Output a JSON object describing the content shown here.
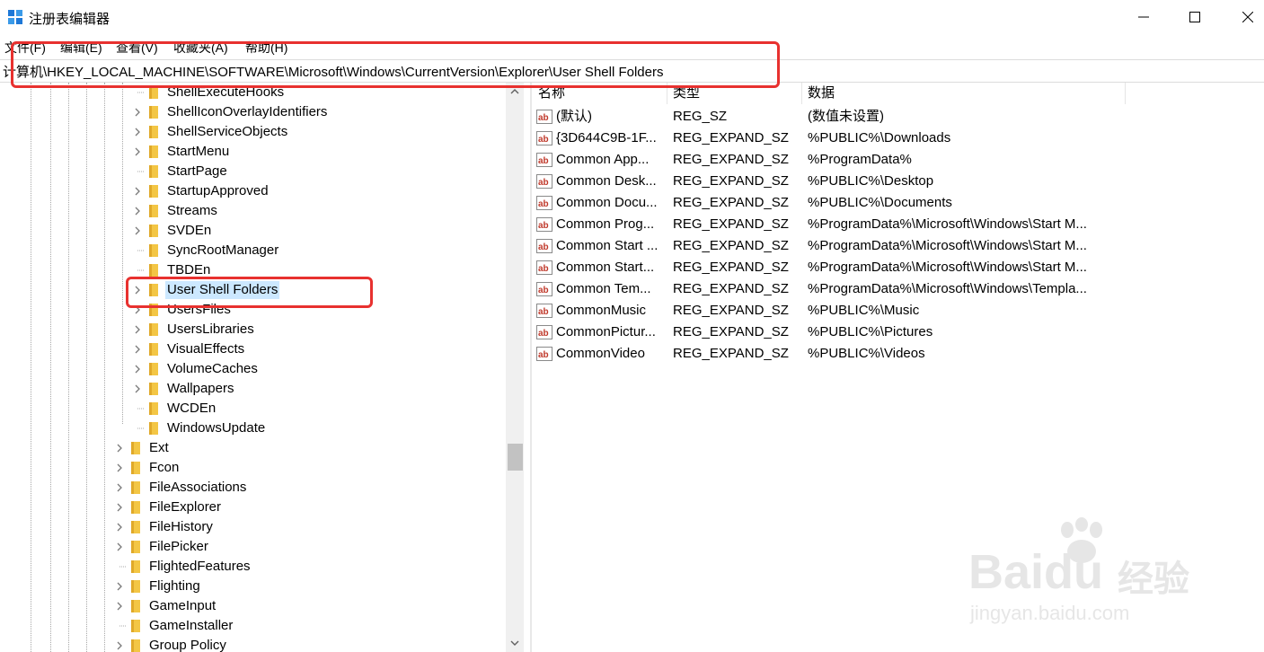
{
  "window": {
    "title": "注册表编辑器",
    "minimize_glyph": "—",
    "maximize_glyph": "☐",
    "close_glyph": "✕"
  },
  "menu": [
    "文件(F)",
    "编辑(E)",
    "查看(V)",
    "收藏夹(A)",
    "帮助(H)"
  ],
  "address": "计算机\\HKEY_LOCAL_MACHINE\\SOFTWARE\\Microsoft\\Windows\\CurrentVersion\\Explorer\\User Shell Folders",
  "tree": {
    "items": [
      {
        "label": "ShellExecuteHooks",
        "level": 2,
        "expandable": false,
        "selected": false
      },
      {
        "label": "ShellIconOverlayIdentifiers",
        "level": 2,
        "expandable": true,
        "selected": false
      },
      {
        "label": "ShellServiceObjects",
        "level": 2,
        "expandable": true,
        "selected": false
      },
      {
        "label": "StartMenu",
        "level": 2,
        "expandable": true,
        "selected": false
      },
      {
        "label": "StartPage",
        "level": 2,
        "expandable": false,
        "selected": false
      },
      {
        "label": "StartupApproved",
        "level": 2,
        "expandable": true,
        "selected": false
      },
      {
        "label": "Streams",
        "level": 2,
        "expandable": true,
        "selected": false
      },
      {
        "label": "SVDEn",
        "level": 2,
        "expandable": true,
        "selected": false
      },
      {
        "label": "SyncRootManager",
        "level": 2,
        "expandable": false,
        "selected": false
      },
      {
        "label": "TBDEn",
        "level": 2,
        "expandable": false,
        "selected": false
      },
      {
        "label": "User Shell Folders",
        "level": 2,
        "expandable": true,
        "selected": true
      },
      {
        "label": "UsersFiles",
        "level": 2,
        "expandable": true,
        "selected": false
      },
      {
        "label": "UsersLibraries",
        "level": 2,
        "expandable": true,
        "selected": false
      },
      {
        "label": "VisualEffects",
        "level": 2,
        "expandable": true,
        "selected": false
      },
      {
        "label": "VolumeCaches",
        "level": 2,
        "expandable": true,
        "selected": false
      },
      {
        "label": "Wallpapers",
        "level": 2,
        "expandable": true,
        "selected": false
      },
      {
        "label": "WCDEn",
        "level": 2,
        "expandable": false,
        "selected": false
      },
      {
        "label": "WindowsUpdate",
        "level": 2,
        "expandable": false,
        "selected": false
      },
      {
        "label": "Ext",
        "level": 1,
        "expandable": true,
        "selected": false
      },
      {
        "label": "Fcon",
        "level": 1,
        "expandable": true,
        "selected": false
      },
      {
        "label": "FileAssociations",
        "level": 1,
        "expandable": true,
        "selected": false
      },
      {
        "label": "FileExplorer",
        "level": 1,
        "expandable": true,
        "selected": false
      },
      {
        "label": "FileHistory",
        "level": 1,
        "expandable": true,
        "selected": false
      },
      {
        "label": "FilePicker",
        "level": 1,
        "expandable": true,
        "selected": false
      },
      {
        "label": "FlightedFeatures",
        "level": 1,
        "expandable": false,
        "selected": false
      },
      {
        "label": "Flighting",
        "level": 1,
        "expandable": true,
        "selected": false
      },
      {
        "label": "GameInput",
        "level": 1,
        "expandable": true,
        "selected": false
      },
      {
        "label": "GameInstaller",
        "level": 1,
        "expandable": false,
        "selected": false
      },
      {
        "label": "Group Policy",
        "level": 1,
        "expandable": true,
        "selected": false
      }
    ]
  },
  "list": {
    "columns": [
      "名称",
      "类型",
      "数据"
    ],
    "rows": [
      {
        "name": "(默认)",
        "type": "REG_SZ",
        "data": "(数值未设置)"
      },
      {
        "name": "{3D644C9B-1F...",
        "type": "REG_EXPAND_SZ",
        "data": "%PUBLIC%\\Downloads"
      },
      {
        "name": "Common App...",
        "type": "REG_EXPAND_SZ",
        "data": "%ProgramData%"
      },
      {
        "name": "Common Desk...",
        "type": "REG_EXPAND_SZ",
        "data": "%PUBLIC%\\Desktop"
      },
      {
        "name": "Common Docu...",
        "type": "REG_EXPAND_SZ",
        "data": "%PUBLIC%\\Documents"
      },
      {
        "name": "Common Prog...",
        "type": "REG_EXPAND_SZ",
        "data": "%ProgramData%\\Microsoft\\Windows\\Start M..."
      },
      {
        "name": "Common Start ...",
        "type": "REG_EXPAND_SZ",
        "data": "%ProgramData%\\Microsoft\\Windows\\Start M..."
      },
      {
        "name": "Common Start...",
        "type": "REG_EXPAND_SZ",
        "data": "%ProgramData%\\Microsoft\\Windows\\Start M..."
      },
      {
        "name": "Common Tem...",
        "type": "REG_EXPAND_SZ",
        "data": "%ProgramData%\\Microsoft\\Windows\\Templa..."
      },
      {
        "name": "CommonMusic",
        "type": "REG_EXPAND_SZ",
        "data": "%PUBLIC%\\Music"
      },
      {
        "name": "CommonPictur...",
        "type": "REG_EXPAND_SZ",
        "data": "%PUBLIC%\\Pictures"
      },
      {
        "name": "CommonVideo",
        "type": "REG_EXPAND_SZ",
        "data": "%PUBLIC%\\Videos"
      }
    ]
  },
  "watermark": {
    "brand": "Baidu",
    "brand_cn": "经验",
    "url": "jingyan.baidu.com"
  },
  "colors": {
    "annotation_red": "#e8312f",
    "folder_yellow": "#f3c645",
    "selection_blue": "#cce8ff"
  }
}
